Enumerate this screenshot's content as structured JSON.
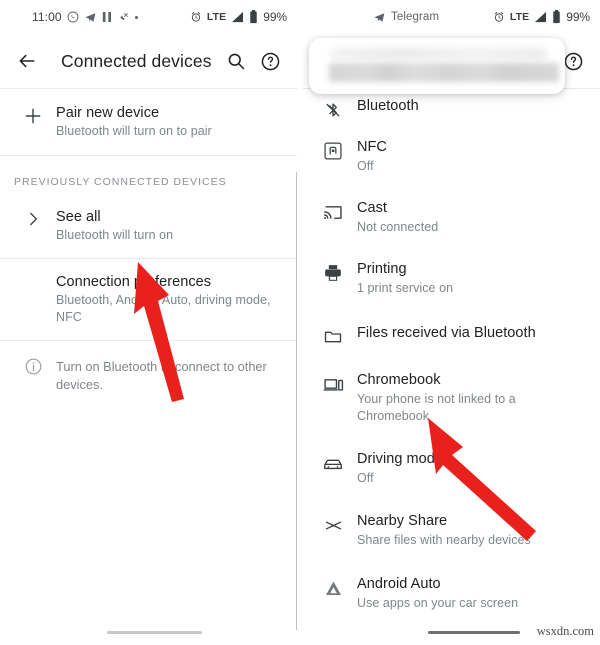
{
  "left_screen": {
    "status_bar": {
      "time": "11:00",
      "icons": [
        "whatsapp-icon",
        "telegram-icon",
        "pause-icon",
        "missed-call-icon",
        "more-dot-icon"
      ],
      "alarm_icon": "alarm-icon",
      "network": "LTE",
      "signal_icon": "signal-bars-icon",
      "battery_icon": "battery-full-icon",
      "battery_percent": "99%"
    },
    "app_bar": {
      "back_icon": "back-arrow-icon",
      "title": "Connected devices",
      "search_icon": "search-icon",
      "help_icon": "help-circle-icon"
    },
    "items": [
      {
        "icon": "plus-icon",
        "title": "Pair new device",
        "subtitle": "Bluetooth will turn on to pair"
      }
    ],
    "section_header": "PREVIOUSLY CONNECTED DEVICES",
    "section_items": [
      {
        "icon": "chevron-right-icon",
        "title": "See all",
        "subtitle": "Bluetooth will turn on"
      },
      {
        "icon": "none",
        "title": "Connection preferences",
        "subtitle": "Bluetooth, Android Auto, driving mode, NFC"
      }
    ],
    "footnote": {
      "icon": "info-circle-icon",
      "text": "Turn on Bluetooth to connect to other devices."
    },
    "nav_handle": "home-gesture-handle"
  },
  "right_screen": {
    "status_bar": {
      "app_icon": "telegram-icon",
      "app_name": "Telegram",
      "alarm_icon": "alarm-icon",
      "network": "LTE",
      "signal_icon": "signal-bars-icon",
      "battery_icon": "battery-full-icon",
      "battery_percent": "99%"
    },
    "app_bar": {
      "redacted_overlay": "blurred-title-card",
      "help_icon": "help-circle-icon"
    },
    "items": [
      {
        "icon": "bluetooth-disabled-icon",
        "title": "Bluetooth",
        "subtitle": ""
      },
      {
        "icon": "nfc-icon",
        "title": "NFC",
        "subtitle": "Off"
      },
      {
        "icon": "cast-icon",
        "title": "Cast",
        "subtitle": "Not connected"
      },
      {
        "icon": "printer-icon",
        "title": "Printing",
        "subtitle": "1 print service on"
      },
      {
        "icon": "folder-icon",
        "title": "Files received via Bluetooth",
        "subtitle": ""
      },
      {
        "icon": "chromebook-icon",
        "title": "Chromebook",
        "subtitle": "Your phone is not linked to a Chromebook"
      },
      {
        "icon": "car-icon",
        "title": "Driving mode",
        "subtitle": "Off"
      },
      {
        "icon": "nearby-share-icon",
        "title": "Nearby Share",
        "subtitle": "Share files with nearby devices"
      },
      {
        "icon": "android-auto-icon",
        "title": "Android Auto",
        "subtitle": "Use apps on your car screen"
      }
    ],
    "nav_handle": "home-gesture-handle"
  },
  "annotations": {
    "arrow_color": "#E8211C",
    "arrows": [
      {
        "name": "arrow-pointing-connection-preferences"
      },
      {
        "name": "arrow-pointing-driving-mode"
      }
    ]
  },
  "watermark": "wsxdn.com"
}
